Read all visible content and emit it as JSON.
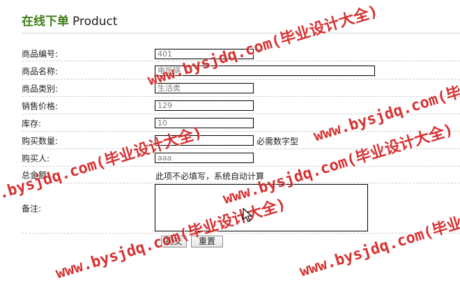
{
  "header": {
    "title_cn": "在线下单",
    "title_en": "Product"
  },
  "form": {
    "product_id": {
      "label": "商品编号:",
      "value": "401",
      "required_mark": "*"
    },
    "product_name": {
      "label": "商品名称:",
      "value": "电饭锅"
    },
    "category": {
      "label": "商品类别:",
      "value": "生活类"
    },
    "price": {
      "label": "销售价格:",
      "value": "129"
    },
    "stock": {
      "label": "库存:",
      "value": "10"
    },
    "quantity": {
      "label": "购买数量:",
      "value": "",
      "hint": "必需数字型"
    },
    "buyer": {
      "label": "购买人:",
      "value": "aaa"
    },
    "total": {
      "label": "总金额:",
      "note": "此项不必填写，系统自动计算"
    },
    "remark": {
      "label": "备注:",
      "value": ""
    },
    "submit_label": "提交",
    "reset_label": "重置"
  },
  "watermark": {
    "text": "www.bysjdq.com(毕业设计大全)"
  },
  "colors": {
    "title_green": "#3f7d17",
    "watermark_red": "#d21414"
  }
}
